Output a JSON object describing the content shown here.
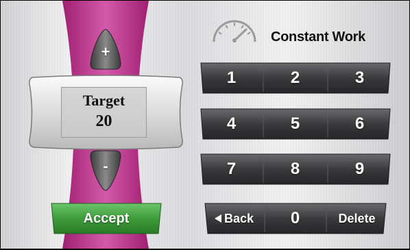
{
  "header": {
    "mode_title": "Constant Work"
  },
  "target": {
    "label": "Target",
    "value": "20"
  },
  "adjust": {
    "increase_glyph": "+",
    "decrease_glyph": "-"
  },
  "accept": {
    "label": "Accept"
  },
  "keypad": {
    "rows": [
      [
        "1",
        "2",
        "3"
      ],
      [
        "4",
        "5",
        "6"
      ],
      [
        "7",
        "8",
        "9"
      ],
      [
        "Back",
        "0",
        "Delete"
      ]
    ]
  },
  "colors": {
    "accent_pink": "#c2348f",
    "accept_green": "#3d9c3a",
    "key_dark": "#3a3a3c"
  },
  "icons": {
    "gauge": "speedometer-icon",
    "back": "back-arrow-icon"
  }
}
